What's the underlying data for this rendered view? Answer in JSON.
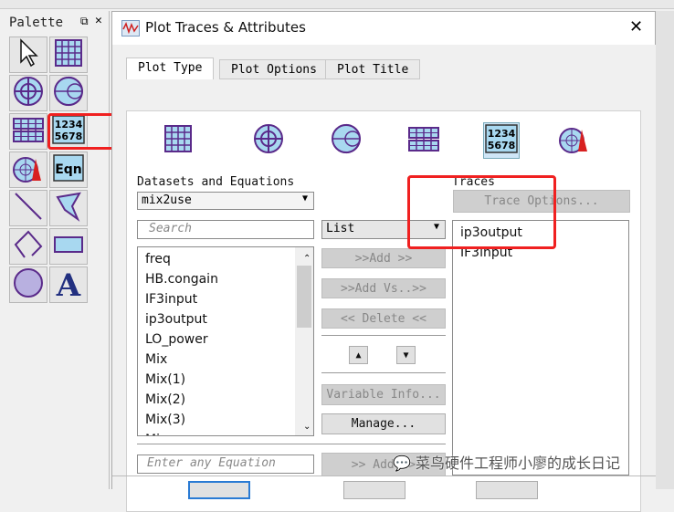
{
  "palette": {
    "title": "Palette",
    "tiles": [
      "pointer",
      "rectangular-plot",
      "polar-plot",
      "smith-chart",
      "stack-plot",
      "list-table",
      "antenna-plot",
      "equation",
      "line",
      "polygon",
      "polyline",
      "rectangle",
      "circle",
      "text"
    ],
    "equation_label": "Eqn",
    "list_label": "1234\n5678"
  },
  "dialog": {
    "title": "Plot Traces & Attributes",
    "tabs": [
      {
        "label": "Plot Type",
        "active": true
      },
      {
        "label": "Plot Options"
      },
      {
        "label": "Plot Title"
      }
    ],
    "plot_types": [
      "rectangular",
      "polar",
      "smith",
      "stack",
      "list",
      "antenna"
    ],
    "selected_plot_type": "list",
    "datasets_label": "Datasets and Equations",
    "dataset": "mix2use",
    "search_placeholder": "Search",
    "view_mode": "List",
    "variables": [
      "freq",
      "HB.congain",
      "IF3input",
      "ip3output",
      "LO_power",
      "Mix",
      "Mix(1)",
      "Mix(2)",
      "Mix(3)",
      "Mix..."
    ],
    "buttons": {
      "add": ">>Add >>",
      "add_vs": ">>Add Vs..>>",
      "delete": "<< Delete <<",
      "variable_info": "Variable Info...",
      "manage": "Manage...",
      "add_equation": ">> Add >>",
      "trace_options": "Trace Options..."
    },
    "equation_placeholder": "Enter any Equation",
    "traces_label": "Traces",
    "traces": [
      "ip3output",
      "IF3input"
    ]
  },
  "watermark": "菜鸟硬件工程师小廖的成长日记",
  "colors": {
    "highlight": "#f02020",
    "icon_fill": "#a8d8f0",
    "icon_stroke": "#5a2a8a"
  }
}
